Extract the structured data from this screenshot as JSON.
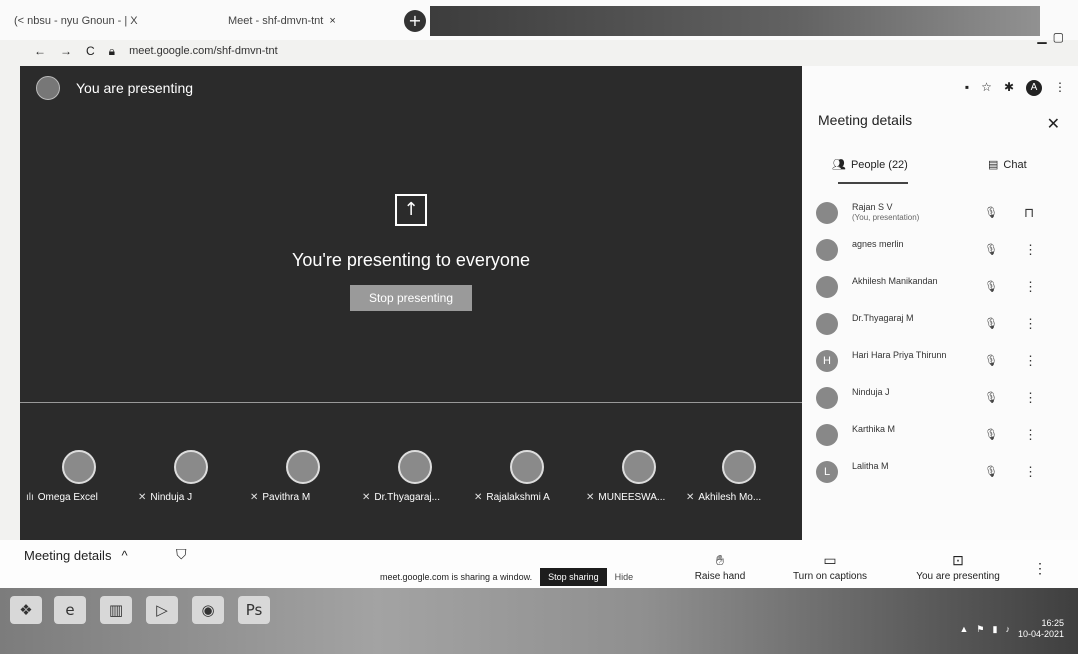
{
  "browser": {
    "tabs": [
      {
        "title": "(< nbsu - nyu Gnoun - | X"
      },
      {
        "title": "Meet - shf-dmvn-tnt"
      }
    ],
    "tab_close": "×",
    "new_tab": "+",
    "address": "meet.google.com/shf-dmvn-tnt"
  },
  "stage": {
    "header": "You are presenting",
    "message": "You're presenting to everyone",
    "stop_button": "Stop presenting",
    "thumbnails": [
      {
        "name": "Omega Excel"
      },
      {
        "name": "Ninduja J"
      },
      {
        "name": "Pavithra M"
      },
      {
        "name": "Dr.Thyagaraj..."
      },
      {
        "name": "Rajalakshmi A"
      },
      {
        "name": "MUNEESWA..."
      },
      {
        "name": "Akhilesh Mo..."
      }
    ]
  },
  "panel": {
    "title": "Meeting details",
    "tabs": {
      "people": "People (22)",
      "chat": "Chat"
    },
    "people": [
      {
        "name": "Rajan S V",
        "sub": "(You, presentation)",
        "initial": "",
        "more": "⊓"
      },
      {
        "name": "agnes merlin",
        "initial": "",
        "more": "⋮"
      },
      {
        "name": "Akhilesh Manikandan",
        "initial": "",
        "more": "⋮"
      },
      {
        "name": "Dr.Thyagaraj M",
        "initial": "",
        "more": "⋮"
      },
      {
        "name": "Hari Hara Priya Thirunn",
        "initial": "H",
        "more": "⋮"
      },
      {
        "name": "Ninduja J",
        "initial": "",
        "more": "⋮"
      },
      {
        "name": "Karthika M",
        "initial": "",
        "more": "⋮"
      },
      {
        "name": "Lalitha M",
        "initial": "L",
        "more": "⋮"
      }
    ]
  },
  "bottom": {
    "meeting_details": "Meeting details",
    "share_notice": "meet.google.com is sharing a window.",
    "stop_sharing": "Stop sharing",
    "hide": "Hide",
    "raise_hand": "Raise hand",
    "captions": "Turn on captions",
    "presenting": "You are presenting"
  },
  "taskbar": {
    "time": "16:25",
    "date": "10-04-2021"
  },
  "colors": {
    "stage_bg": "#2b2b2b",
    "panel_bg": "#fbfbfb",
    "stop_share": "#1d1d1d"
  }
}
